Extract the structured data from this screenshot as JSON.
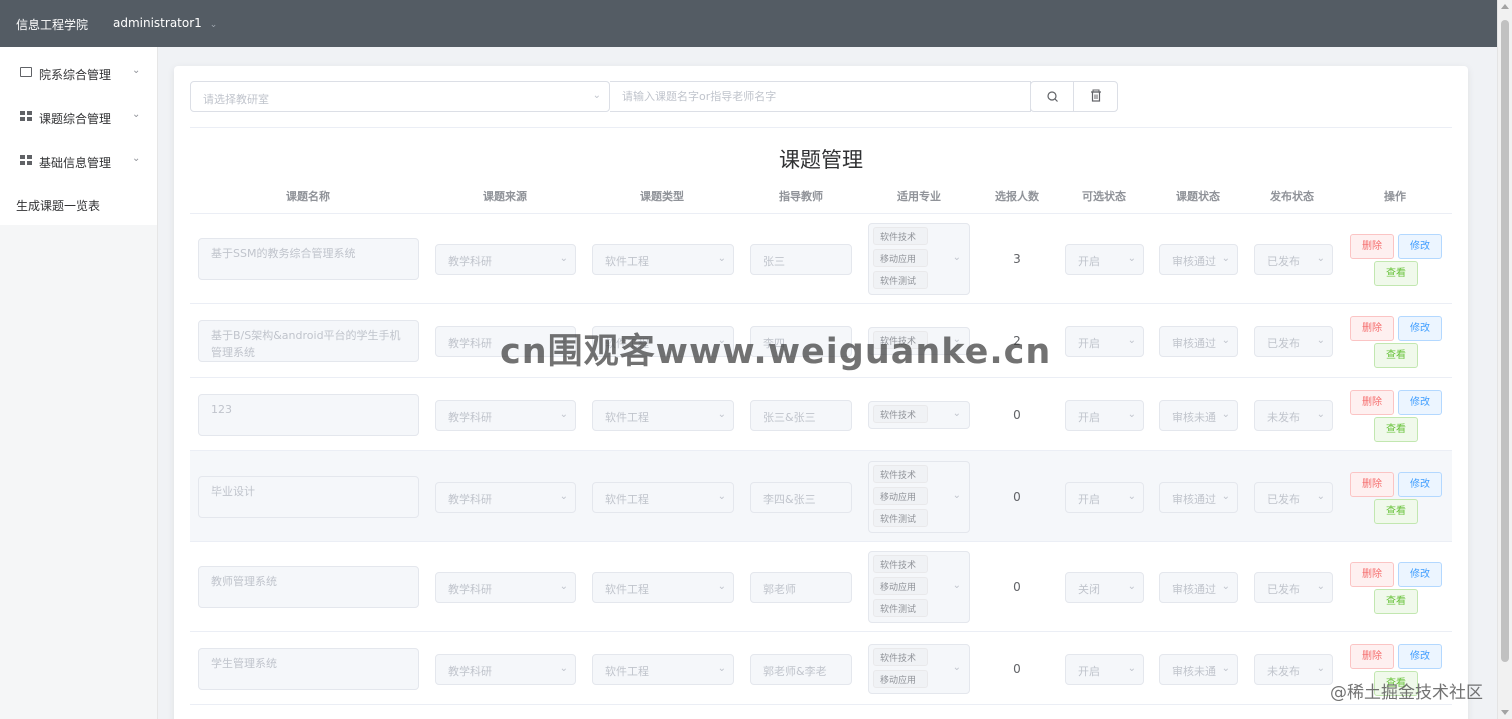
{
  "header": {
    "brand": "信息工程学院",
    "user": "administrator1",
    "user_chevron": "chevron-down-icon"
  },
  "sidebar": {
    "items": [
      {
        "label": "院系综合管理",
        "icon": "mail-icon"
      },
      {
        "label": "课题综合管理",
        "icon": "grid-icon"
      },
      {
        "label": "基础信息管理",
        "icon": "grid-icon"
      }
    ],
    "plain_item": "生成课题一览表"
  },
  "filter": {
    "select_placeholder": "请选择教研室",
    "search_placeholder": "请输入课题名字or指导老师名字",
    "search_icon": "search-icon",
    "delete_icon": "trash-icon"
  },
  "title": "课题管理",
  "columns": [
    "课题名称",
    "课题来源",
    "课题类型",
    "指导教师",
    "适用专业",
    "选报人数",
    "可选状态",
    "课题状态",
    "发布状态",
    "操作"
  ],
  "rows": [
    {
      "name": "基于SSM的教务综合管理系统",
      "source": "教学科研",
      "type": "软件工程",
      "teacher": "张三",
      "majors": [
        "软件技术",
        "移动应用",
        "软件测试"
      ],
      "count": "3",
      "selectable": "开启",
      "status": "审核通过",
      "publish": "已发布"
    },
    {
      "name": "基于B/S架构&android平台的学生手机管理系统",
      "source": "教学科研",
      "type": "软件工程",
      "teacher": "李四",
      "majors": [
        "软件技术"
      ],
      "count": "2",
      "selectable": "开启",
      "status": "审核通过",
      "publish": "已发布"
    },
    {
      "name": "123",
      "source": "教学科研",
      "type": "软件工程",
      "teacher": "张三&张三",
      "majors": [
        "软件技术"
      ],
      "count": "0",
      "selectable": "开启",
      "status": "审核未通",
      "publish": "未发布"
    },
    {
      "name": "毕业设计",
      "source": "教学科研",
      "type": "软件工程",
      "teacher": "李四&张三",
      "majors": [
        "软件技术",
        "移动应用",
        "软件测试"
      ],
      "count": "0",
      "selectable": "开启",
      "status": "审核通过",
      "publish": "已发布"
    },
    {
      "name": "教师管理系统",
      "source": "教学科研",
      "type": "软件工程",
      "teacher": "郭老师",
      "majors": [
        "软件技术",
        "移动应用",
        "软件测试"
      ],
      "count": "0",
      "selectable": "关闭",
      "status": "审核通过",
      "publish": "已发布"
    },
    {
      "name": "学生管理系统",
      "source": "教学科研",
      "type": "软件工程",
      "teacher": "郭老师&李老",
      "majors": [
        "软件技术",
        "移动应用"
      ],
      "count": "0",
      "selectable": "开启",
      "status": "审核未通",
      "publish": "未发布"
    }
  ],
  "actions": {
    "delete": "删除",
    "edit": "修改",
    "view": "查看"
  },
  "watermark": "cn围观客www.weiguanke.cn",
  "corner_watermark": "@稀土掘金技术社区",
  "colors": {
    "topbar": "#545c64",
    "danger": "#f56c6c",
    "primary": "#409eff",
    "success": "#67c23a"
  }
}
